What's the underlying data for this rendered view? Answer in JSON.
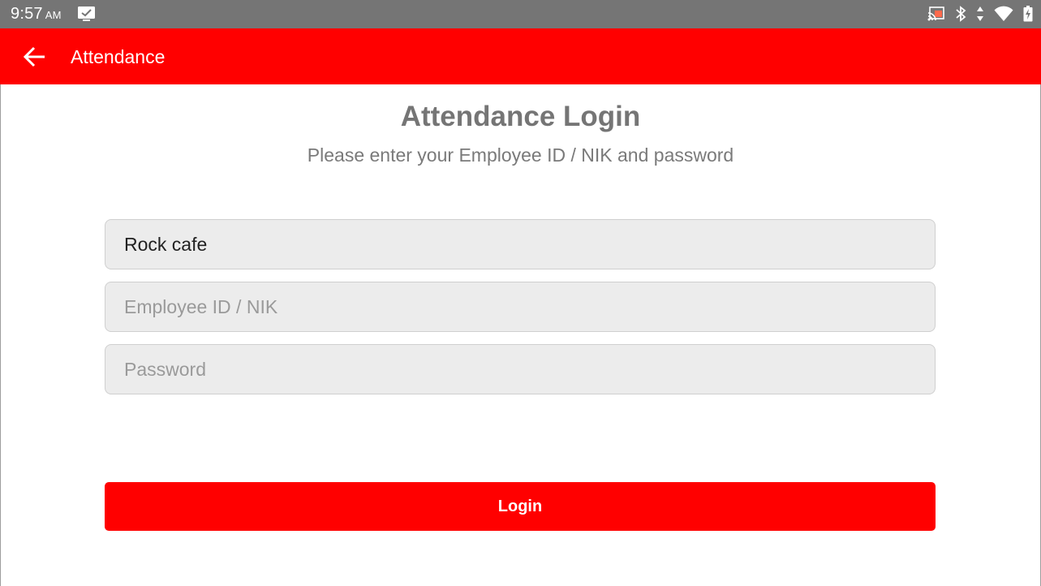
{
  "status_bar": {
    "time": "9:57",
    "ampm": "AM",
    "icons": [
      "notification-check-icon",
      "cast-icon",
      "bluetooth-icon",
      "data-arrows-icon",
      "wifi-icon",
      "battery-charging-icon"
    ]
  },
  "app_bar": {
    "title": "Attendance",
    "back_icon": "back-arrow-icon",
    "color": "#ff0000"
  },
  "main": {
    "title": "Attendance Login",
    "subtitle": "Please enter your Employee ID / NIK and password",
    "store_field": {
      "value": "Rock cafe"
    },
    "employee_field": {
      "value": "",
      "placeholder": "Employee ID / NIK"
    },
    "password_field": {
      "value": "",
      "placeholder": "Password"
    },
    "login_label": "Login"
  }
}
